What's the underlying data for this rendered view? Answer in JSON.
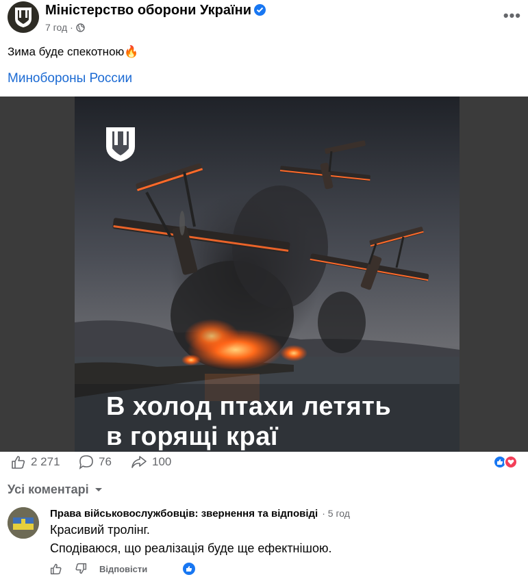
{
  "post": {
    "page_name": "Міністерство оборони України",
    "time": "7 год",
    "separator": "·",
    "text": "Зима буде спекотною",
    "text_emoji": "🔥",
    "link_text": "Минобороны России",
    "image_caption_line1": "В холод птахи летять",
    "image_caption_line2": "в горящі краї",
    "icons": [
      "ministry-trident-logo",
      "verified-badge-icon",
      "globe-icon",
      "more-options-icon"
    ]
  },
  "stats": {
    "likes": "2 271",
    "comments": "76",
    "shares": "100",
    "reactions": [
      "like",
      "love"
    ]
  },
  "comments_filter": {
    "label": "Усі коментарі"
  },
  "comment": {
    "author": "Права військовослужбовців: звернення та відповіді",
    "separator": "·",
    "time": "5 год",
    "line1": "Красивий тролінг.",
    "line2": "Сподіваюся, що реалізація буде ще ефектнішою.",
    "reply_label": "Відповісти"
  },
  "colors": {
    "link": "#1b6ad3",
    "secondary_text": "#65676b",
    "facebook_blue": "#1877f2",
    "love_red": "#f33e58"
  }
}
